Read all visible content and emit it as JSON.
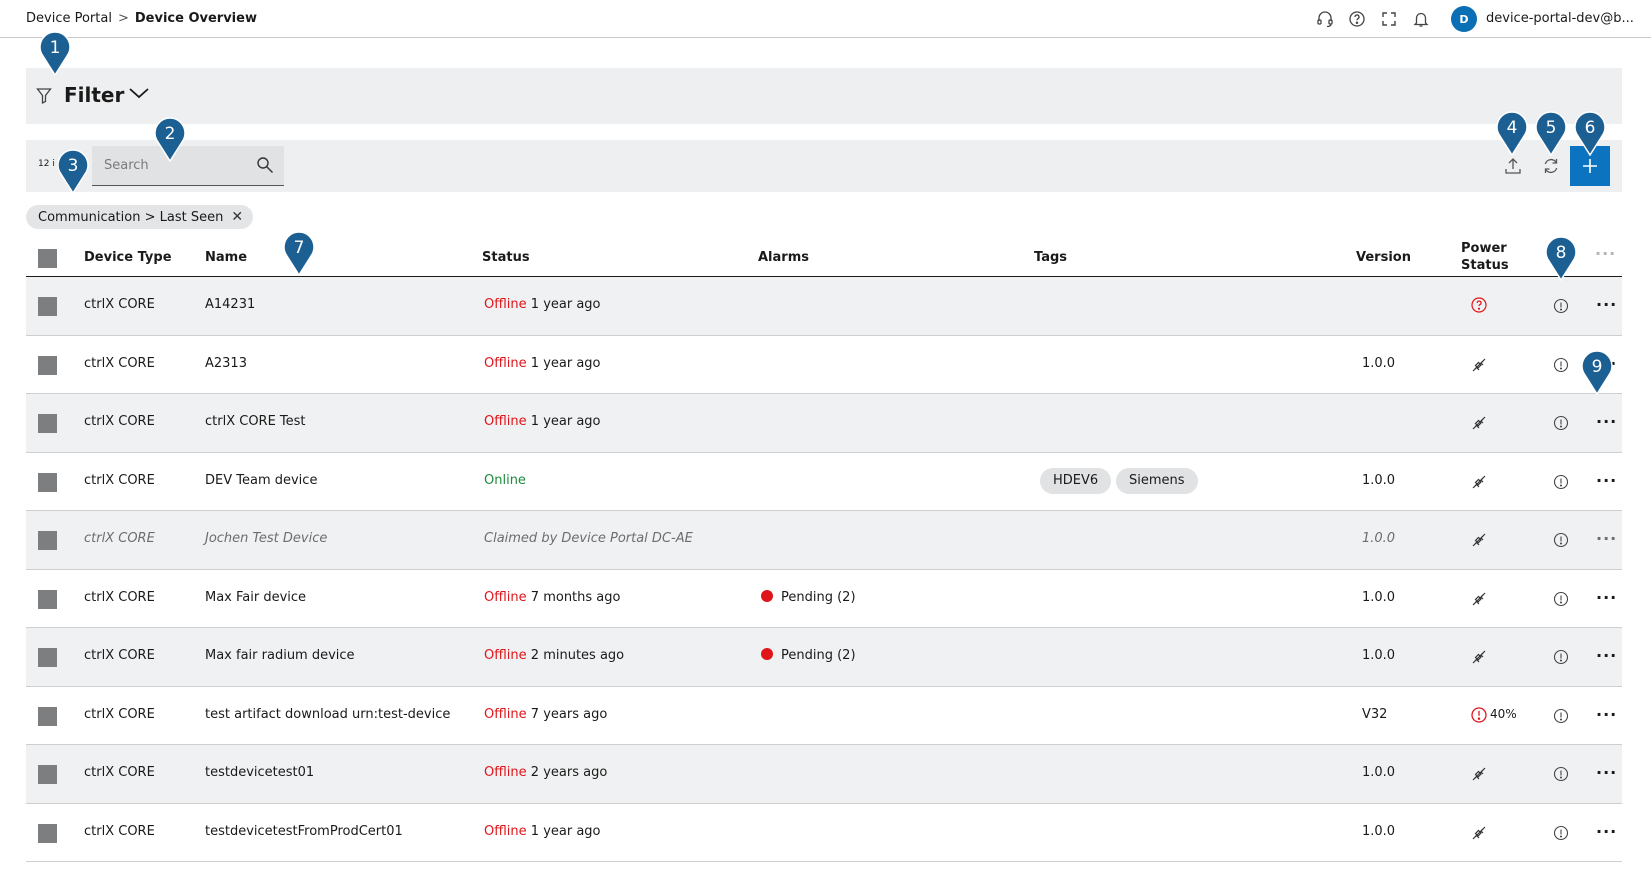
{
  "breadcrumb": {
    "root": "Device Portal",
    "separator": ">",
    "current": "Device Overview"
  },
  "header": {
    "avatar_initial": "D",
    "user": "device-portal-dev@b..."
  },
  "filter": {
    "label": "Filter"
  },
  "toolbar": {
    "count": "12 i",
    "search_placeholder": "Search"
  },
  "chip": {
    "label": "Communication > Last Seen"
  },
  "columns": {
    "device_type": "Device Type",
    "name": "Name",
    "status": "Status",
    "alarms": "Alarms",
    "tags": "Tags",
    "version": "Version",
    "power_status": "Power Status"
  },
  "rows": [
    {
      "type": "ctrlX CORE",
      "name": "A14231",
      "status": "Offline",
      "since": "1 year ago",
      "alarm": "",
      "tags": [],
      "version": "",
      "power": "unknown",
      "power_pct": ""
    },
    {
      "type": "ctrlX CORE",
      "name": "A2313",
      "status": "Offline",
      "since": "1 year ago",
      "alarm": "",
      "tags": [],
      "version": "1.0.0",
      "power": "unplugged",
      "power_pct": ""
    },
    {
      "type": "ctrlX CORE",
      "name": "ctrlX CORE Test",
      "status": "Offline",
      "since": "1 year ago",
      "alarm": "",
      "tags": [],
      "version": "",
      "power": "unplugged",
      "power_pct": ""
    },
    {
      "type": "ctrlX CORE",
      "name": "DEV Team device",
      "status": "Online",
      "since": "",
      "alarm": "",
      "tags": [
        "HDEV6",
        "Siemens"
      ],
      "version": "1.0.0",
      "power": "unplugged",
      "power_pct": ""
    },
    {
      "type": "ctrlX CORE",
      "name": "Jochen Test Device",
      "status": "Claimed by Device Portal DC-AE",
      "since": "",
      "alarm": "",
      "tags": [],
      "version": "1.0.0",
      "power": "unplugged",
      "power_pct": "",
      "claimed": true
    },
    {
      "type": "ctrlX CORE",
      "name": "Max Fair device",
      "status": "Offline",
      "since": "7 months ago",
      "alarm": "Pending (2)",
      "tags": [],
      "version": "1.0.0",
      "power": "unplugged",
      "power_pct": ""
    },
    {
      "type": "ctrlX CORE",
      "name": "Max fair radium device",
      "status": "Offline",
      "since": "2 minutes ago",
      "alarm": "Pending (2)",
      "tags": [],
      "version": "1.0.0",
      "power": "unplugged",
      "power_pct": ""
    },
    {
      "type": "ctrlX CORE",
      "name": "test artifact download urn:test-device",
      "status": "Offline",
      "since": "7 years ago",
      "alarm": "",
      "tags": [],
      "version": "V32",
      "power": "warning",
      "power_pct": "40%"
    },
    {
      "type": "ctrlX CORE",
      "name": "testdevicetest01",
      "status": "Offline",
      "since": "2 years ago",
      "alarm": "",
      "tags": [],
      "version": "1.0.0",
      "power": "unplugged",
      "power_pct": ""
    },
    {
      "type": "ctrlX CORE",
      "name": "testdevicetestFromProdCert01",
      "status": "Offline",
      "since": "1 year ago",
      "alarm": "",
      "tags": [],
      "version": "1.0.0",
      "power": "unplugged",
      "power_pct": ""
    }
  ],
  "markers": [
    "1",
    "2",
    "3",
    "4",
    "5",
    "6",
    "7",
    "8",
    "9"
  ],
  "colors": {
    "accent": "#0b73bf",
    "marker": "#1b5f93",
    "offline": "#e0151a",
    "online": "#1e8a3c"
  }
}
